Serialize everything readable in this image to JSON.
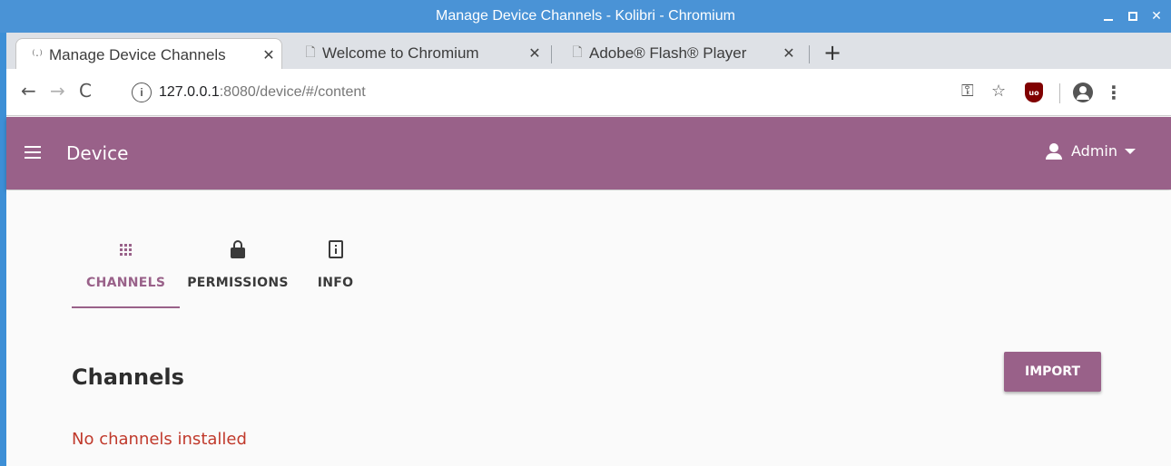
{
  "window": {
    "title": "Manage Device Channels - Kolibri - Chromium"
  },
  "tabs": [
    {
      "label": "Manage Device Channels",
      "icon": "broadcast-icon",
      "active": true
    },
    {
      "label": "Welcome to Chromium",
      "icon": "page-icon"
    },
    {
      "label": "Adobe® Flash® Player",
      "icon": "page-icon"
    }
  ],
  "omnibox": {
    "host": "127.0.0.1",
    "path": ":8080/device/#/content"
  },
  "appbar": {
    "title": "Device",
    "user": "Admin",
    "color": "#996189"
  },
  "nav": {
    "items": [
      {
        "label": "CHANNELS",
        "icon": "channels-grid-icon",
        "active": true
      },
      {
        "label": "PERMISSIONS",
        "icon": "lock-icon"
      },
      {
        "label": "INFO",
        "icon": "device-info-icon"
      }
    ]
  },
  "main": {
    "heading": "Channels",
    "import_label": "IMPORT",
    "empty_message": "No channels installed",
    "empty_color": "#c0392b"
  }
}
